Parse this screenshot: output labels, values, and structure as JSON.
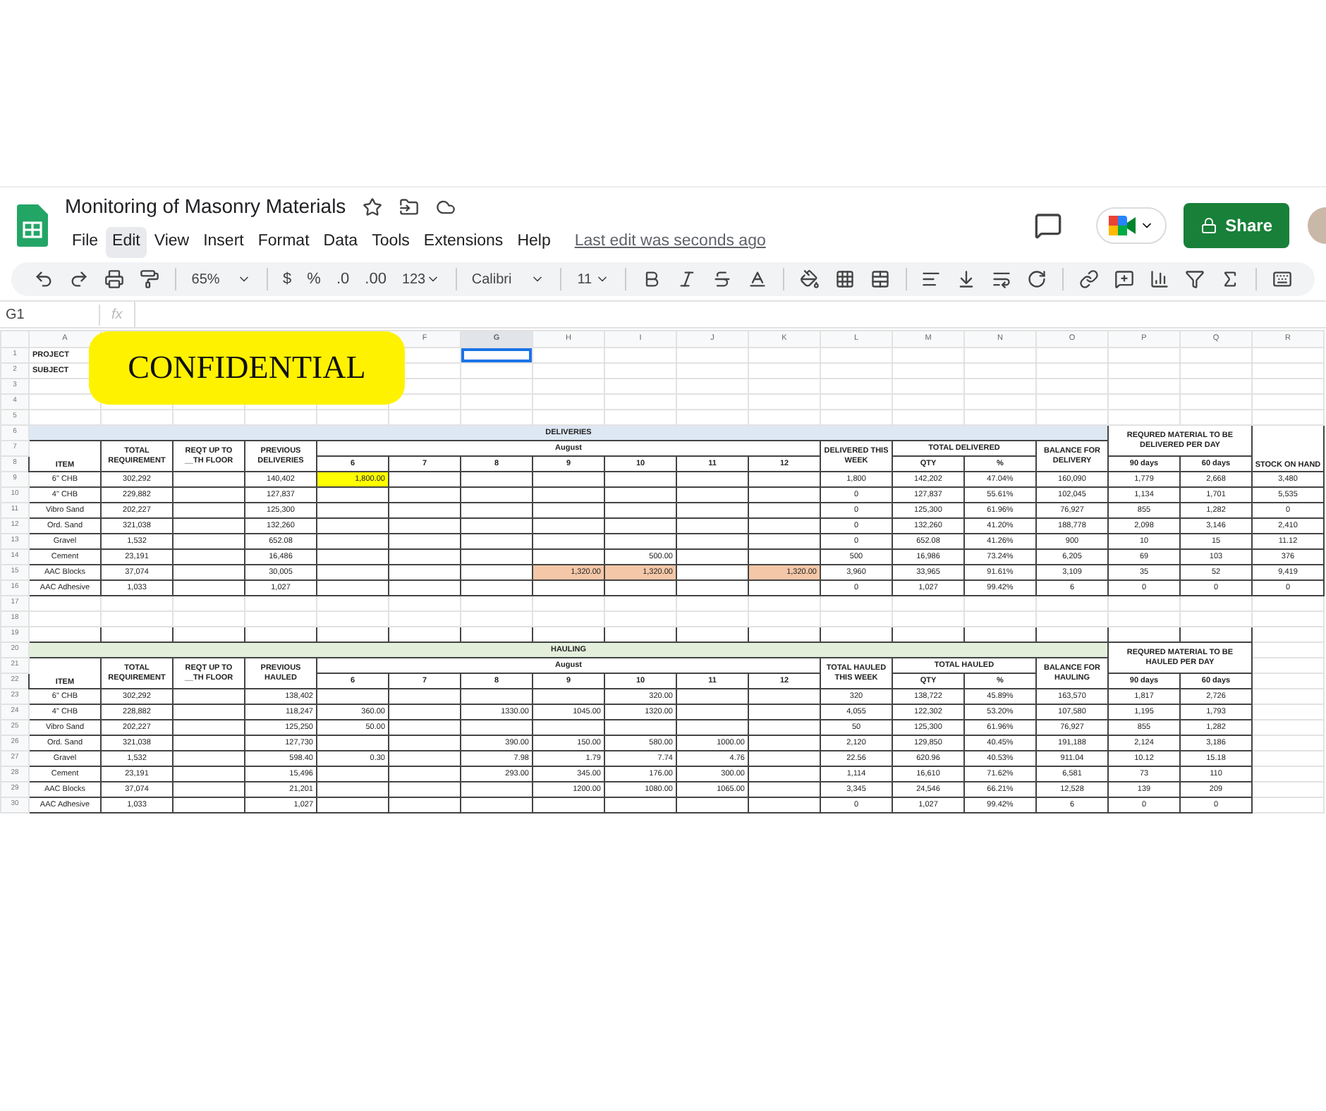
{
  "app": {
    "title": "Monitoring of Masonry Materials",
    "last_edit": "Last edit was seconds ago",
    "share": "Share",
    "menu": [
      {
        "label": "File",
        "selected": false
      },
      {
        "label": "Edit",
        "selected": true
      },
      {
        "label": "View",
        "selected": false
      },
      {
        "label": "Insert",
        "selected": false
      },
      {
        "label": "Format",
        "selected": false
      },
      {
        "label": "Data",
        "selected": false
      },
      {
        "label": "Tools",
        "selected": false
      },
      {
        "label": "Extensions",
        "selected": false
      },
      {
        "label": "Help",
        "selected": false
      }
    ]
  },
  "toolbar": {
    "zoom": "65%",
    "currency": "$",
    "percent": "%",
    "decrease_decimal": ".0",
    "increase_decimal": ".00",
    "number_format": "123",
    "font": "Calibri",
    "font_size": "11"
  },
  "formula_bar": {
    "cell": "G1",
    "fx": "fx"
  },
  "sheet": {
    "columns_left": [
      {
        "label": "A",
        "selected": false
      }
    ],
    "columns_right": [
      {
        "label": "F",
        "selected": false
      },
      {
        "label": "G",
        "selected": true
      },
      {
        "label": "H",
        "selected": false
      },
      {
        "label": "I",
        "selected": false
      },
      {
        "label": "J",
        "selected": false
      },
      {
        "label": "K",
        "selected": false
      },
      {
        "label": "L",
        "selected": false
      },
      {
        "label": "M",
        "selected": false
      },
      {
        "label": "N",
        "selected": false
      },
      {
        "label": "O",
        "selected": false
      },
      {
        "label": "P",
        "selected": false
      },
      {
        "label": "Q",
        "selected": false
      },
      {
        "label": "R",
        "selected": false
      }
    ],
    "row_numbers": [
      "1",
      "2",
      "3",
      "4",
      "5",
      "6",
      "7",
      "8",
      "9",
      "10",
      "11",
      "12",
      "13",
      "14",
      "15",
      "16",
      "17",
      "18",
      "19",
      "20",
      "21",
      "22",
      "23",
      "24",
      "25",
      "26",
      "27",
      "28",
      "29",
      "30"
    ],
    "project_label": "PROJECT",
    "subject_label": "SUBJECT",
    "deliveries": {
      "header": {
        "title": "DELIVERIES",
        "item": "ITEM",
        "total_requirement": "TOTAL REQUIREMENT",
        "reqt": "REQT UP TO __TH FLOOR",
        "previous": "PREVIOUS DELIVERIES",
        "month": "August",
        "days": [
          "6",
          "7",
          "8",
          "9",
          "10",
          "11",
          "12"
        ],
        "this_week": "DELIVERED THIS WEEK",
        "total": "TOTAL DELIVERED",
        "qty": "QTY",
        "pct": "%",
        "balance": "BALANCE FOR DELIVERY",
        "per_day": "REQURED MATERIAL TO BE DELIVERED PER DAY",
        "d90": "90 days",
        "d60": "60 days",
        "stock": "STOCK ON HAND"
      },
      "rows": [
        {
          "item": "6\" CHB",
          "total_requirement": "302,292",
          "previous": "140,402",
          "days": {
            "d6": {
              "value": "1,800.00",
              "color": "#ffff00"
            }
          },
          "this_week": "1,800",
          "qty": "142,202",
          "pct": "47.04%",
          "balance": "160,090",
          "d90": "1,779",
          "d60": "2,668",
          "stock": "3,480"
        },
        {
          "item": "4\" CHB",
          "total_requirement": "229,882",
          "previous": "127,837",
          "this_week": "0",
          "qty": "127,837",
          "pct": "55.61%",
          "balance": "102,045",
          "d90": "1,134",
          "d60": "1,701",
          "stock": "5,535"
        },
        {
          "item": "Vibro Sand",
          "total_requirement": "202,227",
          "previous": "125,300",
          "this_week": "0",
          "qty": "125,300",
          "pct": "61.96%",
          "balance": "76,927",
          "d90": "855",
          "d60": "1,282",
          "stock": "0"
        },
        {
          "item": "Ord. Sand",
          "total_requirement": "321,038",
          "previous": "132,260",
          "this_week": "0",
          "qty": "132,260",
          "pct": "41.20%",
          "balance": "188,778",
          "d90": "2,098",
          "d60": "3,146",
          "stock": "2,410"
        },
        {
          "item": "Gravel",
          "total_requirement": "1,532",
          "previous": "652.08",
          "this_week": "0",
          "qty": "652.08",
          "pct": "41.26%",
          "balance": "900",
          "d90": "10",
          "d60": "15",
          "stock": "11.12"
        },
        {
          "item": "Cement",
          "total_requirement": "23,191",
          "previous": "16,486",
          "days": {
            "d10": {
              "value": "500.00"
            }
          },
          "this_week": "500",
          "qty": "16,986",
          "pct": "73.24%",
          "balance": "6,205",
          "d90": "69",
          "d60": "103",
          "stock": "376"
        },
        {
          "item": "AAC Blocks",
          "total_requirement": "37,074",
          "previous": "30,005",
          "days": {
            "d9": {
              "value": "1,320.00",
              "color": "#f4c7a8"
            },
            "d10": {
              "value": "1,320.00",
              "color": "#f4c7a8"
            },
            "d12": {
              "value": "1,320.00",
              "color": "#f4c7a8"
            }
          },
          "this_week": "3,960",
          "qty": "33,965",
          "pct": "91.61%",
          "balance": "3,109",
          "d90": "35",
          "d60": "52",
          "stock": "9,419"
        },
        {
          "item": "AAC Adhesive",
          "total_requirement": "1,033",
          "previous": "1,027",
          "this_week": "0",
          "qty": "1,027",
          "pct": "99.42%",
          "balance": "6",
          "d90": "0",
          "d60": "0",
          "stock": "0"
        }
      ]
    },
    "hauling": {
      "header": {
        "title": "HAULING",
        "item": "ITEM",
        "total_requirement": "TOTAL REQUIREMENT",
        "reqt": "REQT UP TO __TH FLOOR",
        "previous": "PREVIOUS HAULED",
        "month": "August",
        "days": [
          "6",
          "7",
          "8",
          "9",
          "10",
          "11",
          "12"
        ],
        "this_week": "TOTAL HAULED THIS WEEK",
        "total": "TOTAL HAULED",
        "qty": "QTY",
        "pct": "%",
        "balance": "BALANCE FOR HAULING",
        "per_day": "REQURED MATERIAL TO BE HAULED PER DAY",
        "d90": "90 days",
        "d60": "60 days"
      },
      "rows": [
        {
          "item": "6\" CHB",
          "total_requirement": "302,292",
          "previous": "138,402",
          "days": {
            "d10": {
              "value": "320.00"
            }
          },
          "this_week": "320",
          "qty": "138,722",
          "pct": "45.89%",
          "balance": "163,570",
          "d90": "1,817",
          "d60": "2,726"
        },
        {
          "item": "4\" CHB",
          "total_requirement": "228,882",
          "previous": "118,247",
          "days": {
            "d6": {
              "value": "360.00"
            },
            "d8": {
              "value": "1330.00"
            },
            "d9": {
              "value": "1045.00"
            },
            "d10": {
              "value": "1320.00"
            }
          },
          "this_week": "4,055",
          "qty": "122,302",
          "pct": "53.20%",
          "balance": "107,580",
          "d90": "1,195",
          "d60": "1,793"
        },
        {
          "item": "Vibro Sand",
          "total_requirement": "202,227",
          "previous": "125,250",
          "days": {
            "d6": {
              "value": "50.00"
            }
          },
          "this_week": "50",
          "qty": "125,300",
          "pct": "61.96%",
          "balance": "76,927",
          "d90": "855",
          "d60": "1,282"
        },
        {
          "item": "Ord. Sand",
          "total_requirement": "321,038",
          "previous": "127,730",
          "days": {
            "d8": {
              "value": "390.00"
            },
            "d9": {
              "value": "150.00"
            },
            "d10": {
              "value": "580.00"
            },
            "d11": {
              "value": "1000.00"
            }
          },
          "this_week": "2,120",
          "qty": "129,850",
          "pct": "40.45%",
          "balance": "191,188",
          "d90": "2,124",
          "d60": "3,186"
        },
        {
          "item": "Gravel",
          "total_requirement": "1,532",
          "previous": "598.40",
          "days": {
            "d6": {
              "value": "0.30"
            },
            "d8": {
              "value": "7.98"
            },
            "d9": {
              "value": "1.79"
            },
            "d10": {
              "value": "7.74"
            },
            "d11": {
              "value": "4.76"
            }
          },
          "this_week": "22.56",
          "qty": "620.96",
          "pct": "40.53%",
          "balance": "911.04",
          "d90": "10.12",
          "d60": "15.18"
        },
        {
          "item": "Cement",
          "total_requirement": "23,191",
          "previous": "15,496",
          "days": {
            "d8": {
              "value": "293.00"
            },
            "d9": {
              "value": "345.00"
            },
            "d10": {
              "value": "176.00"
            },
            "d11": {
              "value": "300.00"
            }
          },
          "this_week": "1,114",
          "qty": "16,610",
          "pct": "71.62%",
          "balance": "6,581",
          "d90": "73",
          "d60": "110"
        },
        {
          "item": "AAC Blocks",
          "total_requirement": "37,074",
          "previous": "21,201",
          "days": {
            "d9": {
              "value": "1200.00"
            },
            "d10": {
              "value": "1080.00"
            },
            "d11": {
              "value": "1065.00"
            }
          },
          "this_week": "3,345",
          "qty": "24,546",
          "pct": "66.21%",
          "balance": "12,528",
          "d90": "139",
          "d60": "209"
        },
        {
          "item": "AAC Adhesive",
          "total_requirement": "1,033",
          "previous": "1,027",
          "this_week": "0",
          "qty": "1,027",
          "pct": "99.42%",
          "balance": "6",
          "d90": "0",
          "d60": "0"
        }
      ]
    }
  },
  "overlay": {
    "text": "CONFIDENTIAL"
  }
}
